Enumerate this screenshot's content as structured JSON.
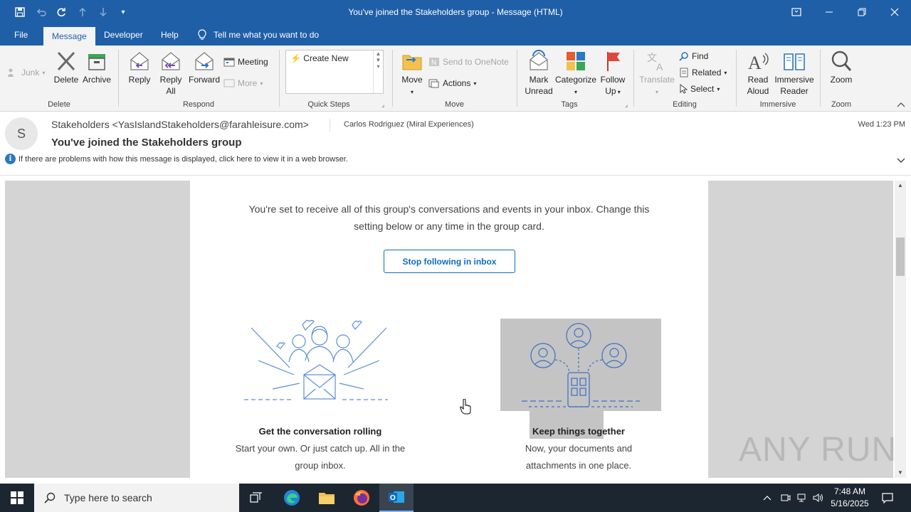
{
  "window": {
    "title": "You've joined the Stakeholders group  -  Message (HTML)"
  },
  "ribbon_tabs": [
    {
      "label": "File"
    },
    {
      "label": "Message"
    },
    {
      "label": "Developer"
    },
    {
      "label": "Help"
    }
  ],
  "tell_me": "Tell me what you want to do",
  "ribbon": {
    "junk": "Junk",
    "delete": "Delete",
    "archive": "Archive",
    "group_delete": "Delete",
    "reply": "Reply",
    "reply_all_1": "Reply",
    "reply_all_2": "All",
    "forward": "Forward",
    "meeting": "Meeting",
    "more": "More",
    "group_respond": "Respond",
    "create_new": "Create New",
    "group_quicksteps": "Quick Steps",
    "move": "Move",
    "send_onenote": "Send to OneNote",
    "actions": "Actions",
    "group_move": "Move",
    "mark_unread_1": "Mark",
    "mark_unread_2": "Unread",
    "categorize": "Categorize",
    "follow_up_1": "Follow",
    "follow_up_2": "Up",
    "group_tags": "Tags",
    "translate": "Translate",
    "find": "Find",
    "related": "Related",
    "select": "Select",
    "group_editing": "Editing",
    "read_aloud_1": "Read",
    "read_aloud_2": "Aloud",
    "immersive_1": "Immersive",
    "immersive_2": "Reader",
    "group_immersive": "Immersive",
    "zoom": "Zoom",
    "group_zoom": "Zoom"
  },
  "message": {
    "avatar_initial": "S",
    "from": "Stakeholders <YasIslandStakeholders@farahleisure.com>",
    "to": "Carlos Rodriguez (Miral Experiences)",
    "subject": "You've joined the Stakeholders group",
    "time": "Wed 1:23 PM",
    "info": "If there are problems with how this message is displayed, click here to view it in a web browser."
  },
  "email_body": {
    "intro": "You're set to receive all of this group's conversations and events in your inbox. Change this setting below or any time in the group card.",
    "stop_button": "Stop following in inbox",
    "features": [
      {
        "title": "Get the conversation rolling",
        "desc": "Start your own. Or just catch up. All in the group inbox."
      },
      {
        "title": "Keep things together",
        "desc": "Now, your documents and attachments in one place."
      }
    ]
  },
  "watermark": "ANY RUN",
  "taskbar": {
    "search_placeholder": "Type here to search",
    "time": "7:48 AM",
    "date": "5/16/2025"
  },
  "colors": {
    "titlebar": "#1f5fa8",
    "accent": "#0f6cbd",
    "taskbar": "#1c2630"
  }
}
